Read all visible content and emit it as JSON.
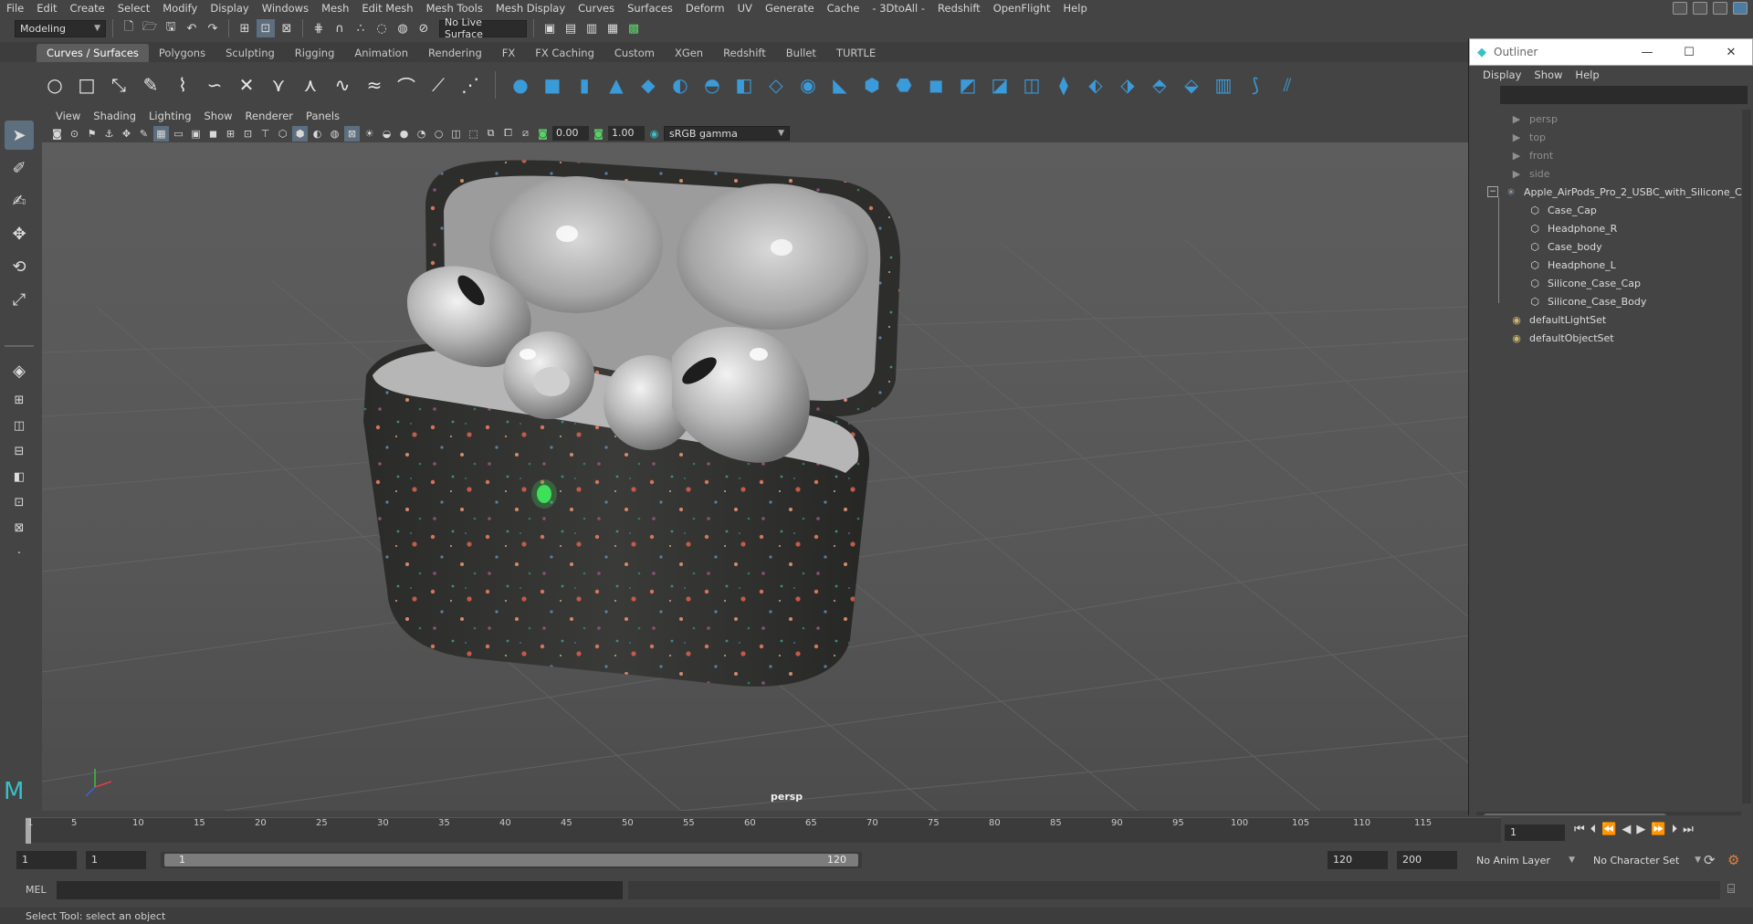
{
  "menubar": {
    "items": [
      "File",
      "Edit",
      "Create",
      "Select",
      "Modify",
      "Display",
      "Windows",
      "Mesh",
      "Edit Mesh",
      "Mesh Tools",
      "Mesh Display",
      "Curves",
      "Surfaces",
      "Deform",
      "UV",
      "Generate",
      "Cache",
      "- 3DtoAll -",
      "Redshift",
      "OpenFlight",
      "Help"
    ]
  },
  "statusline": {
    "mode": "Modeling",
    "live_surface": "No Live Surface"
  },
  "shelf": {
    "tabs": [
      "Curves / Surfaces",
      "Polygons",
      "Sculpting",
      "Rigging",
      "Animation",
      "Rendering",
      "FX",
      "FX Caching",
      "Custom",
      "XGen",
      "Redshift",
      "Bullet",
      "TURTLE"
    ],
    "active_tab": "Curves / Surfaces"
  },
  "panel": {
    "menu": [
      "View",
      "Shading",
      "Lighting",
      "Show",
      "Renderer",
      "Panels"
    ],
    "exposure": "0.00",
    "gamma": "1.00",
    "colorspace": "sRGB gamma",
    "camera_label": "persp"
  },
  "outliner": {
    "title": "Outliner",
    "menu": [
      "Display",
      "Show",
      "Help"
    ],
    "cameras": [
      "persp",
      "top",
      "front",
      "side"
    ],
    "root": "Apple_AirPods_Pro_2_USBC_with_Silicone_C",
    "children": [
      "Case_Cap",
      "Headphone_R",
      "Case_body",
      "Headphone_L",
      "Silicone_Case_Cap",
      "Silicone_Case_Body"
    ],
    "sets": [
      "defaultLightSet",
      "defaultObjectSet"
    ]
  },
  "timeslider": {
    "ticks": [
      "1",
      "5",
      "10",
      "15",
      "20",
      "25",
      "30",
      "35",
      "40",
      "45",
      "50",
      "55",
      "60",
      "65",
      "70",
      "75",
      "80",
      "85",
      "90",
      "95",
      "100",
      "105",
      "110",
      "115"
    ],
    "current_frame": "1"
  },
  "rangeslider": {
    "start": "1",
    "playback_start": "1",
    "range_start_label": "1",
    "range_end_label": "120",
    "playback_end": "120",
    "end": "200",
    "anim_layer": "No Anim Layer",
    "character_set": "No Character Set"
  },
  "cmdline": {
    "lang": "MEL"
  },
  "helpline": {
    "text": "Select Tool: select an object"
  },
  "colors": {
    "accent": "#5d6f7f",
    "case": "#2f302e",
    "bud": "#c9c9c9"
  }
}
